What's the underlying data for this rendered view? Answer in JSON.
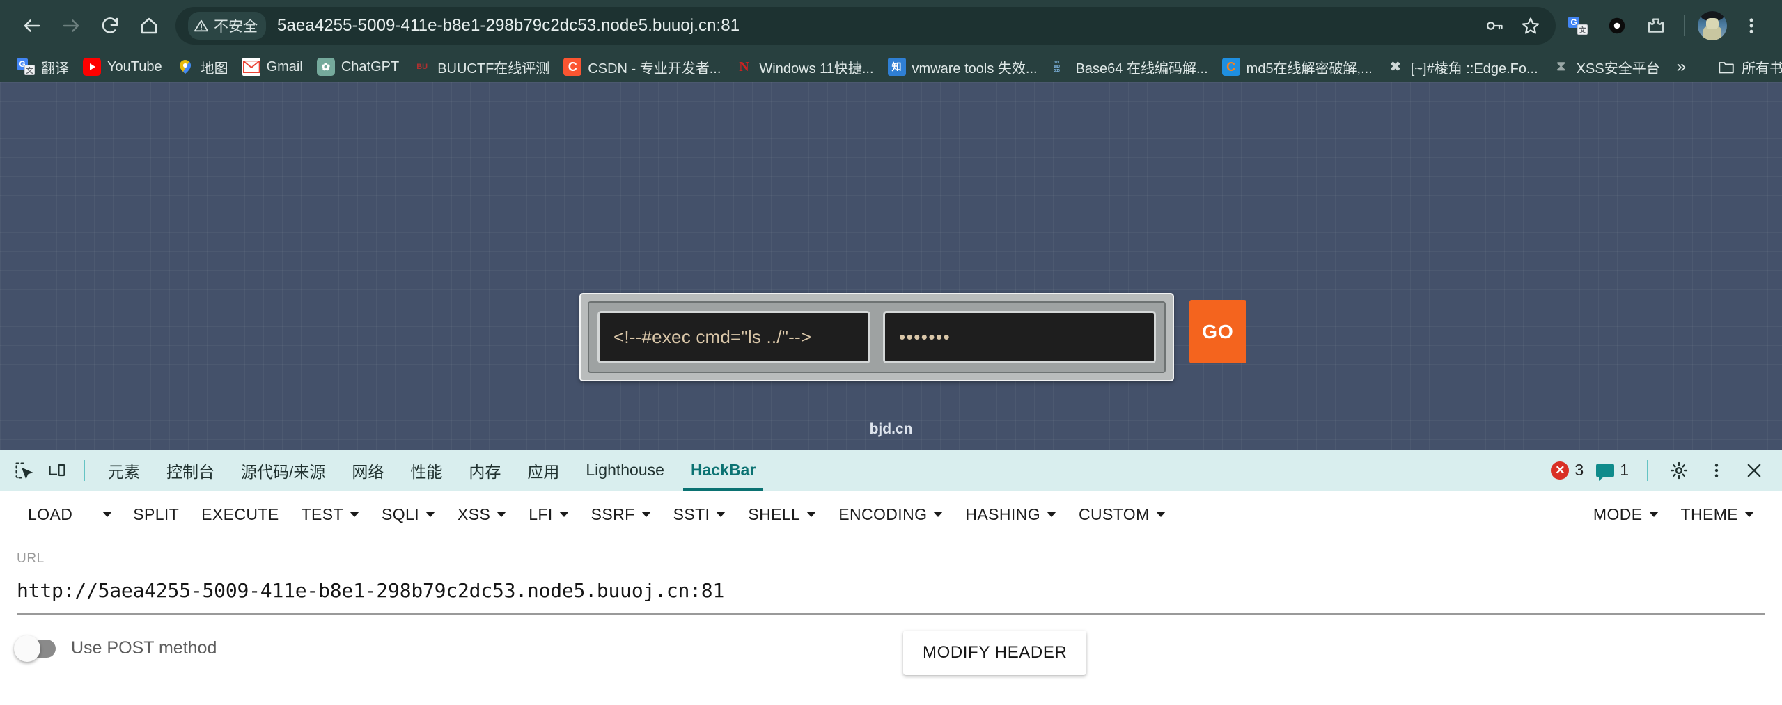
{
  "browser": {
    "back_label": "Back",
    "forward_label": "Forward",
    "reload_label": "Reload",
    "home_label": "Home",
    "security_badge": "不安全",
    "url": "5aea4255-5009-411e-b8e1-298b79c2dc53.node5.buuoj.cn:81",
    "passwords_label": "Passwords",
    "bookmark_label": "Bookmark this tab",
    "translate_label": "Translate",
    "extension_label": "Extension",
    "extensions_label": "Extensions",
    "profile_label": "Profile",
    "menu_label": "Customize and control Chrome"
  },
  "bookmarks": {
    "items": [
      {
        "label": "翻译",
        "icon": "google-translate-icon",
        "kind": "translate"
      },
      {
        "label": "YouTube",
        "icon": "youtube-icon",
        "kind": "yt"
      },
      {
        "label": "地图",
        "icon": "google-maps-icon",
        "kind": "maps"
      },
      {
        "label": "Gmail",
        "icon": "gmail-icon",
        "kind": "gmail"
      },
      {
        "label": "ChatGPT",
        "icon": "chatgpt-icon",
        "kind": "chatgpt"
      },
      {
        "label": "BUUCTF在线评测",
        "icon": "buuctf-icon",
        "kind": "buuctf"
      },
      {
        "label": "CSDN - 专业开发者...",
        "icon": "csdn-icon",
        "kind": "csdn"
      },
      {
        "label": "Windows 11快捷...",
        "icon": "windows-icon",
        "kind": "win"
      },
      {
        "label": "vmware tools 失效...",
        "icon": "zhihu-icon",
        "kind": "vmware"
      },
      {
        "label": "Base64 在线编码解...",
        "icon": "base64-icon",
        "kind": "base64"
      },
      {
        "label": "md5在线解密破解,...",
        "icon": "md5-icon",
        "kind": "md5"
      },
      {
        "label": "[~]#棱角 ::Edge.Fo...",
        "icon": "edge-forum-icon",
        "kind": "edge"
      },
      {
        "label": "XSS安全平台",
        "icon": "xss-icon",
        "kind": "xss"
      }
    ],
    "overflow_label": "»",
    "all_bookmarks_label": "所有书签"
  },
  "page": {
    "username_value": "<!--#exec cmd=\"ls ../\"-->",
    "password_value": "•••••••",
    "go_label": "GO",
    "footer": "bjd.cn"
  },
  "devtools": {
    "inspect_label": "Inspect element",
    "device_label": "Toggle device toolbar",
    "tabs": [
      {
        "label": "元素",
        "active": false
      },
      {
        "label": "控制台",
        "active": false
      },
      {
        "label": "源代码/来源",
        "active": false
      },
      {
        "label": "网络",
        "active": false
      },
      {
        "label": "性能",
        "active": false
      },
      {
        "label": "内存",
        "active": false
      },
      {
        "label": "应用",
        "active": false
      },
      {
        "label": "Lighthouse",
        "active": false
      },
      {
        "label": "HackBar",
        "active": true
      }
    ],
    "error_count": "3",
    "message_count": "1",
    "settings_label": "Settings",
    "more_label": "More options",
    "close_label": "Close DevTools"
  },
  "hackbar": {
    "toolbar": [
      {
        "label": "LOAD",
        "caret": false
      },
      {
        "label": "",
        "caret": true,
        "caret_only": true
      },
      {
        "label": "SPLIT",
        "caret": false
      },
      {
        "label": "EXECUTE",
        "caret": false
      },
      {
        "label": "TEST",
        "caret": true
      },
      {
        "label": "SQLI",
        "caret": true
      },
      {
        "label": "XSS",
        "caret": true
      },
      {
        "label": "LFI",
        "caret": true
      },
      {
        "label": "SSRF",
        "caret": true
      },
      {
        "label": "SSTI",
        "caret": true
      },
      {
        "label": "SHELL",
        "caret": true
      },
      {
        "label": "ENCODING",
        "caret": true
      },
      {
        "label": "HASHING",
        "caret": true
      },
      {
        "label": "CUSTOM",
        "caret": true
      }
    ],
    "toolbar_right": [
      {
        "label": "MODE",
        "caret": true
      },
      {
        "label": "THEME",
        "caret": true
      }
    ],
    "url_label": "URL",
    "url_value": "http://5aea4255-5009-411e-b8e1-298b79c2dc53.node5.buuoj.cn:81",
    "post_toggle_label": "Use POST method",
    "post_toggle_on": false,
    "modify_header_label": "MODIFY HEADER"
  },
  "colors": {
    "chrome_bg": "#28403f",
    "omnibox_bg": "#1d3231",
    "page_bg": "#44516a",
    "accent_orange": "#f4641e",
    "devtools_tabbar": "#d9eeee",
    "devtools_active": "#0b7272",
    "error_red": "#d93025"
  }
}
